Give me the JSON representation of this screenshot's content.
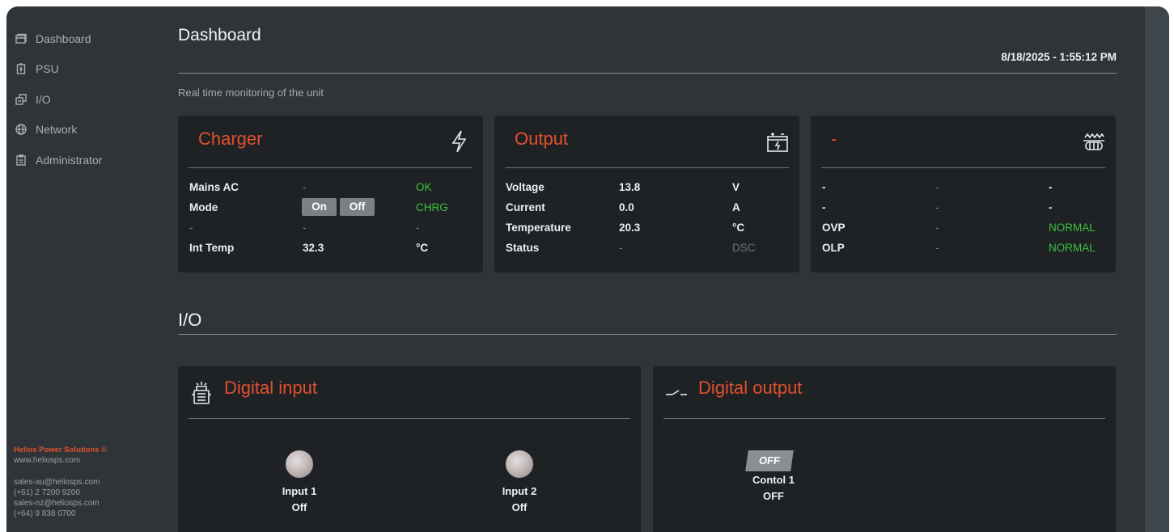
{
  "sidebar": {
    "items": [
      {
        "label": "Dashboard",
        "icon": "dashboard-icon"
      },
      {
        "label": "PSU",
        "icon": "battery-icon"
      },
      {
        "label": "I/O",
        "icon": "io-icon"
      },
      {
        "label": "Network",
        "icon": "globe-icon"
      },
      {
        "label": "Administrator",
        "icon": "clipboard-icon"
      }
    ],
    "footer": {
      "brand": "Helios Power Solutions ©",
      "website": "www.heliosps.com",
      "au_email": "sales-au@heliosps.com",
      "au_phone": "(+61) 2 7200 9200",
      "nz_email": "sales-nz@heliosps.com",
      "nz_phone": "(+64) 9 838 0700"
    }
  },
  "header": {
    "title": "Dashboard",
    "datetime": "8/18/2025 - 1:55:12 PM",
    "subtitle": "Real time monitoring of the unit"
  },
  "charger": {
    "title": "Charger",
    "icon": "lightning-icon",
    "rows": [
      {
        "label": "Mains AC",
        "value": "-",
        "status": "OK"
      },
      {
        "label": "Mode",
        "on_label": "On",
        "off_label": "Off",
        "status": "CHRG"
      },
      {
        "label": "-",
        "value": "-",
        "status": "-"
      },
      {
        "label": "Int Temp",
        "value": "32.3",
        "unit": "°C"
      }
    ]
  },
  "output": {
    "title": "Output",
    "icon": "battery-charge-icon",
    "rows": [
      {
        "label": "Voltage",
        "value": "13.8",
        "unit": "V"
      },
      {
        "label": "Current",
        "value": "0.0",
        "unit": "A"
      },
      {
        "label": "Temperature",
        "value": "20.3",
        "unit": "°C"
      },
      {
        "label": "Status",
        "value": "-",
        "unit": "DSC"
      }
    ]
  },
  "protection": {
    "title": "-",
    "icon": "heater-icon",
    "rows": [
      {
        "label": "-",
        "value": "-",
        "status": "-"
      },
      {
        "label": "-",
        "value": "-",
        "status": "-"
      },
      {
        "label": "OVP",
        "value": "-",
        "status": "NORMAL"
      },
      {
        "label": "OLP",
        "value": "-",
        "status": "NORMAL"
      }
    ]
  },
  "io_section": {
    "title": "I/O",
    "digital_input": {
      "title": "Digital input",
      "icon": "input-device-icon",
      "inputs": [
        {
          "name": "Input 1",
          "state": "Off"
        },
        {
          "name": "Input 2",
          "state": "Off"
        }
      ]
    },
    "digital_output": {
      "title": "Digital output",
      "icon": "switch-icon",
      "outputs": [
        {
          "button": "OFF",
          "name": "Contol 1",
          "state": "OFF"
        }
      ]
    }
  },
  "colors": {
    "accent": "#e2502e",
    "ok_green": "#39c23f",
    "card_bg": "#1f2225",
    "page_bg": "#2e3438"
  }
}
